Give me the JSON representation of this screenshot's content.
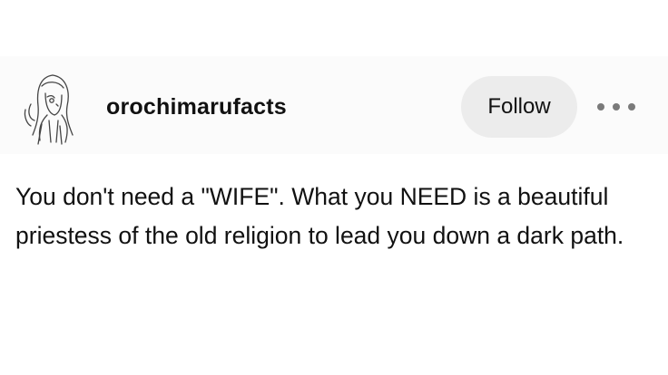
{
  "post": {
    "author": {
      "username": "orochimarufacts",
      "avatar_icon": "sketch-avatar-icon"
    },
    "follow_label": "Follow",
    "more_icon": "more-options-icon",
    "text": "You don't need a \"WIFE\". What you NEED is a beautiful priestess of the old religion to lead you down a dark path."
  },
  "colors": {
    "background": "#ffffff",
    "header_background": "#fbfbfb",
    "button_background": "#ececec",
    "text": "#111111",
    "dots": "#7a7a7a"
  }
}
